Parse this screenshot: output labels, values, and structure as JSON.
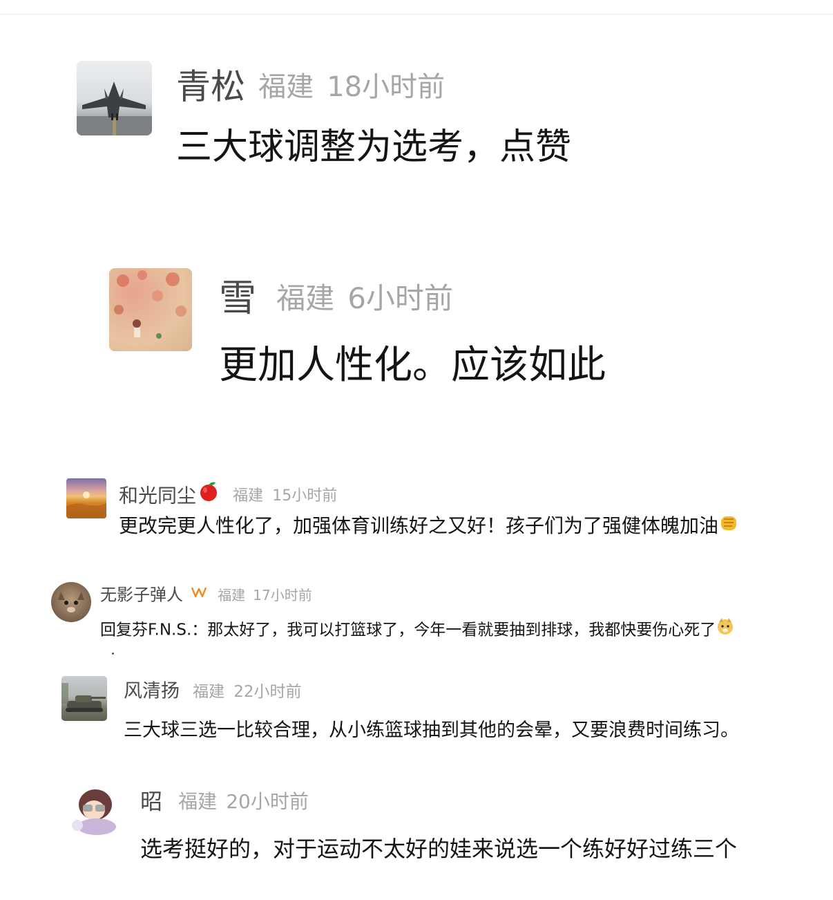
{
  "comments": [
    {
      "name": "青松",
      "location": "福建",
      "time": "18小时前",
      "text": "三大球调整为选考，点赞",
      "avatar_icon": "fighter-jet-avatar"
    },
    {
      "name": "雪",
      "location": "福建",
      "time": "6小时前",
      "text": "更加人性化。应该如此",
      "avatar_icon": "orchard-painting-avatar"
    },
    {
      "name": "和光同尘",
      "badge_icon": "apple-emoji",
      "location": "福建",
      "time": "15小时前",
      "text": "更改完更人性化了，加强体育训练好之又好！孩子们为了强健体魄加油",
      "trailing_icon": "fist-emoji",
      "avatar_icon": "wheat-field-sunset-avatar"
    },
    {
      "name": "无影子弹人",
      "badge_icon": "orange-w-badge",
      "location": "福建",
      "time": "17小时前",
      "text": "回复芬F.N.S.：那太好了，我可以打篮球了，今年一看就要抽到排球，我都快要伤心死了",
      "trailing_icon": "doge-emoji",
      "avatar_icon": "cat-avatar"
    },
    {
      "name": "风清扬",
      "location": "福建",
      "time": "22小时前",
      "text": "三大球三选一比较合理，从小练篮球抽到其他的会晕，又要浪费时间练习。",
      "avatar_icon": "tank-avatar"
    },
    {
      "name": "昭",
      "location": "福建",
      "time": "20小时前",
      "text": "选考挺好的，对于运动不太好的娃来说选一个练好好过练三个",
      "avatar_icon": "cartoon-girl-avatar"
    }
  ],
  "colors": {
    "name": "#4a4a4a",
    "meta": "#a6a6a6",
    "text": "#141414"
  }
}
